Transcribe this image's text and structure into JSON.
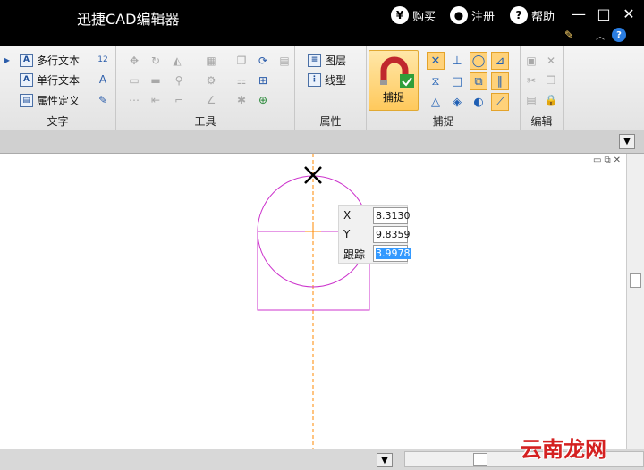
{
  "app": {
    "title": "迅捷CAD编辑器"
  },
  "titlebar": {
    "buy_label": "购买",
    "buy_icon": "yen-icon",
    "register_label": "注册",
    "register_icon": "user-icon",
    "help_label": "帮助",
    "help_icon": "question-icon"
  },
  "ribbon": {
    "groups": {
      "text": "文字",
      "tools": "工具",
      "props": "属性",
      "snap": "捕捉",
      "edit": "编辑"
    },
    "text_items": [
      "多行文本",
      "单行文本",
      "属性定义"
    ],
    "prop_items": [
      "图层",
      "线型"
    ],
    "snap_button": "捕捉"
  },
  "coords": {
    "x_label": "X",
    "x_value": "8.3130",
    "y_label": "Y",
    "y_value": "9.8359",
    "track_label": "跟踪",
    "track_value": "3.9978"
  },
  "colors": {
    "geometry": "#cc33cc",
    "crosshair": "#ff8800",
    "accent": "#ffc95c"
  },
  "watermark": "云南龙网"
}
